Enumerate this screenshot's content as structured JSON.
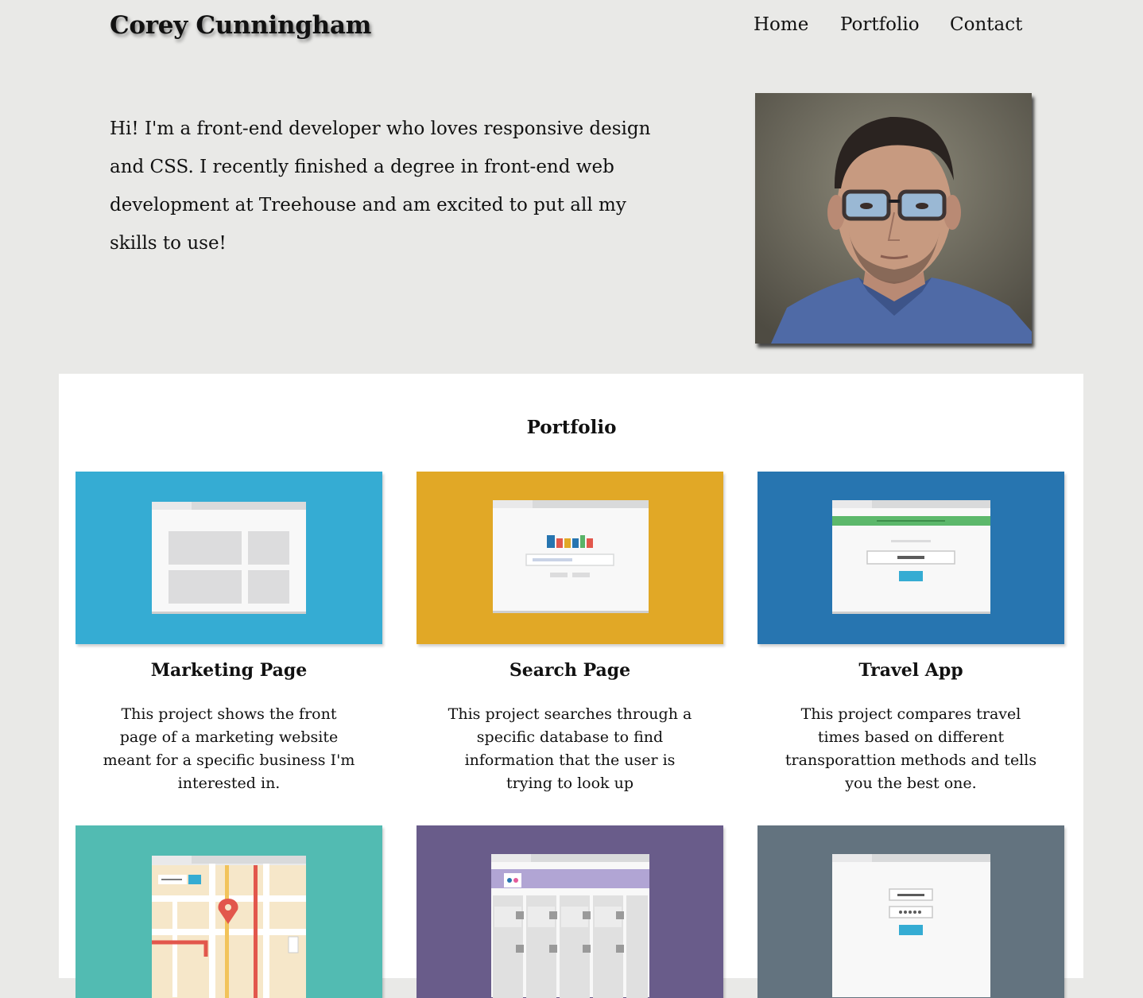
{
  "header": {
    "site_title": "Corey Cunningham",
    "nav": [
      "Home",
      "Portfolio",
      "Contact"
    ]
  },
  "about": {
    "bio": "Hi! I'm a front-end developer who loves responsive design and CSS. I recently finished a degree in front-end web development at Treehouse and am excited to put all my skills to use!",
    "photo_icon": "profile-photo"
  },
  "portfolio": {
    "heading": "Portfolio",
    "projects": [
      {
        "title": "Marketing Page",
        "description": "This project shows the front page of a marketing website meant for a specific business I'm interested in.",
        "color": "#35acd3"
      },
      {
        "title": "Search Page",
        "description": "This project searches through a specific database to find information that the user is trying to look up",
        "color": "#e1a826"
      },
      {
        "title": "Travel App",
        "description": "This project compares travel times based on different transporattion methods and tells you the best one.",
        "color": "#2775b0"
      },
      {
        "color": "#52bbb2"
      },
      {
        "color": "#695c8a"
      },
      {
        "color": "#63737f"
      }
    ]
  },
  "colors": {
    "page_background": "#e9e9e7",
    "panel_background": "#ffffff"
  }
}
